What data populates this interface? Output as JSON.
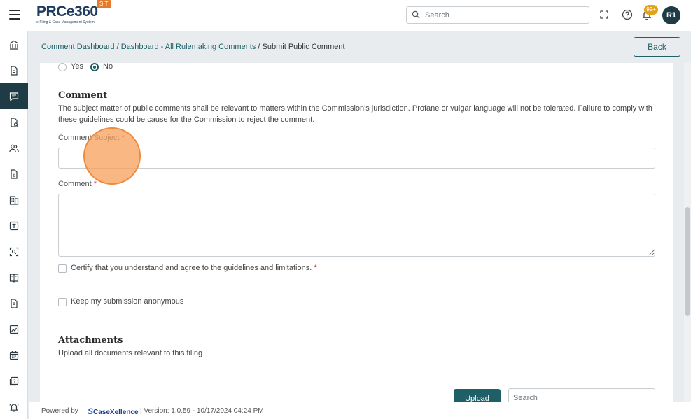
{
  "header": {
    "logo_main": "PRCe360",
    "logo_sub": "e-Filing & Case Management System",
    "env_badge": "SIT",
    "search_placeholder": "Search",
    "notifications_count": "99+",
    "avatar_initials": "R1"
  },
  "sidebar": {
    "items": [
      {
        "icon": "bank-icon"
      },
      {
        "icon": "document-icon"
      },
      {
        "icon": "comment-icon",
        "active": true
      },
      {
        "icon": "search-document-icon"
      },
      {
        "icon": "users-icon"
      },
      {
        "icon": "invoice-icon"
      },
      {
        "icon": "building-icon"
      },
      {
        "icon": "text-box-icon"
      },
      {
        "icon": "scan-icon"
      },
      {
        "icon": "book-icon"
      },
      {
        "icon": "file-text-icon"
      },
      {
        "icon": "chart-icon"
      },
      {
        "icon": "calendar-icon"
      },
      {
        "icon": "help-book-icon"
      },
      {
        "icon": "bell-alert-icon"
      }
    ]
  },
  "breadcrumb": {
    "items": [
      "Comment Dashboard",
      "Dashboard - All Rulemaking Comments",
      "Submit Public Comment"
    ],
    "separator": "/"
  },
  "back_label": "Back",
  "form": {
    "radio": {
      "yes_label": "Yes",
      "no_label": "No",
      "selected": "No"
    },
    "comment_section_title": "Comment",
    "comment_section_desc": "The subject matter of public comments shall be relevant to matters within the Commission's jurisdiction. Profane or vulgar language will not be tolerated. Failure to comply with these guidelines could be cause for the Commission to reject the comment.",
    "subject_label": "Comment Subject",
    "subject_value": "",
    "comment_label": "Comment",
    "comment_value": "",
    "required_mark": "*",
    "certify_label": "Certify that you understand and agree to the guidelines and limitations.",
    "anonymous_label": "Keep my submission anonymous",
    "attachments_title": "Attachments",
    "attachments_desc": "Upload all documents relevant to this filing",
    "upload_label": "Upload",
    "attach_search_placeholder": "Search"
  },
  "footer": {
    "powered_by": "Powered by",
    "brand": "CaseXellence",
    "version": "|   Version: 1.0.59 - 10/17/2024 04:24 PM"
  },
  "colors": {
    "primary": "#1f6068",
    "sidebar_active": "#1f3b45",
    "badge_orange": "#e57a2a",
    "notif_badge": "#e3a21a",
    "required": "#d33333"
  }
}
